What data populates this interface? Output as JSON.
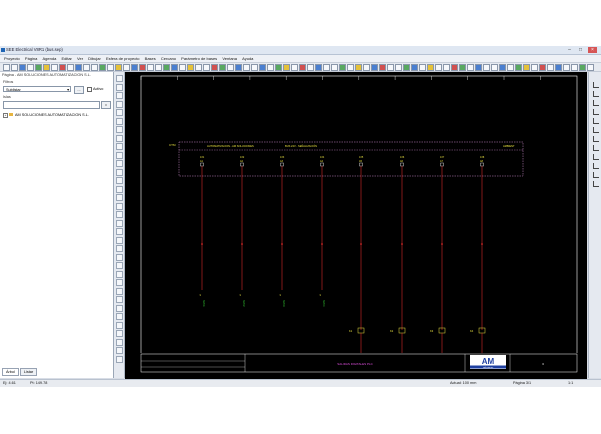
{
  "window": {
    "title": "SEE Electrical V8R1 (bus.sep)"
  },
  "menu": [
    "Proyecto",
    "Página",
    "Agenda",
    "Editar",
    "Ver",
    "Dibujar",
    "Esfera de proyecto",
    "Bases",
    "Cercano",
    "Parámetro de bases",
    "Ventana",
    "Ayuda"
  ],
  "sidebar": {
    "header": "Página - AM SOLUCIONES AUTOMATIZACION S.L.",
    "filter_label": "Filtros",
    "select_value": "Sublistar",
    "browse_button": "...",
    "active_checkbox": "Activo",
    "name_label": "Islas",
    "go_button": "=",
    "tree_root": "AM SOLUCIONES AUTOMATIZACION S.L.",
    "tabs": [
      "Árbol",
      "Listar"
    ]
  },
  "drawing": {
    "bus_label": "PLC BUS SOLUCION 24",
    "header_center": "BUS 24V - SEÑALIZACIÓN",
    "header_left": "AUTOMATIZACION - AM SOLUCIONES",
    "header_right": "AMBIENT",
    "panel_ref": "CTM",
    "bus_end_left": "+24",
    "bus_end_right": "+24",
    "channels": [
      {
        "top": "1X1",
        "mid": "A1",
        "bottom_tag": "SMD1",
        "desc": "MANIOBRA DESCR 1 SEÑAL RESP"
      },
      {
        "top": "1X2",
        "mid": "A2",
        "bottom_tag": "SMD2",
        "desc": "MANIOBRA DESCR 2 SEÑAL RESP"
      },
      {
        "top": "1X3",
        "mid": "A3",
        "bottom_tag": "SMD3",
        "desc": "MANIOBRA DESCR 3 SEÑAL RESP"
      },
      {
        "top": "1X4",
        "mid": "A4",
        "bottom_tag": "SMD4",
        "desc": "MANIOBRA DESCR 4 SEÑAL RESP"
      },
      {
        "top": "1X5",
        "mid": "A5",
        "bottom_tag": "K1",
        "desc": "MANIOBRA CIERRE"
      },
      {
        "top": "1X6",
        "mid": "A6",
        "bottom_tag": "K2",
        "desc": "MANIOBRA"
      },
      {
        "top": "1X7",
        "mid": "A7",
        "bottom_tag": "K3",
        "desc": "MANIOBRA"
      },
      {
        "top": "1X8",
        "mid": "A8",
        "bottom_tag": "K4",
        "desc": "SEÑAL CIERRE"
      }
    ],
    "title_block": {
      "logo": "AM",
      "logo_sub": "soluciones",
      "title": "SALIDAS DIGITALES PLC",
      "sheet": "3"
    }
  },
  "status": {
    "left": "Ej: 4.61",
    "left2": "Pt: 149.78",
    "center": "Actual: 100 mm",
    "page": "Página 3/1",
    "zoom": "1:1"
  },
  "colors": {
    "canvas": "#000000",
    "frame": "#ffffff",
    "wire_red": "#ff3030",
    "bus_box": "#d08cd0",
    "text_yellow": "#e8e040",
    "text_magenta": "#e050e0",
    "green": "#30c030",
    "logo_blue": "#1e3fa0"
  }
}
